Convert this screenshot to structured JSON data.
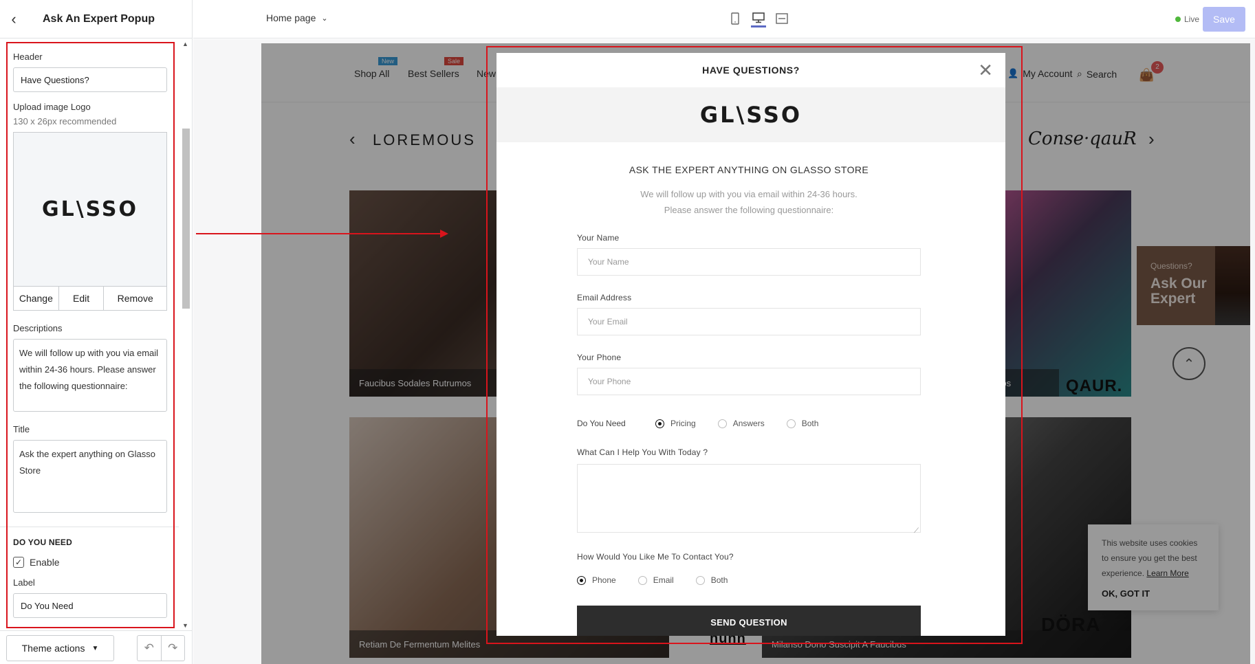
{
  "sidebar": {
    "title": "Ask An Expert Popup",
    "header_label": "Header",
    "header_value": "Have Questions?",
    "upload_label": "Upload image Logo",
    "upload_hint": "130 x 26px recommended",
    "logo_text": "GL\\SSO",
    "image_buttons": [
      "Change",
      "Edit",
      "Remove"
    ],
    "descriptions_label": "Descriptions",
    "descriptions_value": "We will follow up with you via email within 24-36 hours. Please answer the following questionnaire:",
    "title_label": "Title",
    "title_value": "Ask the expert anything on Glasso Store",
    "section_do_you_need": "DO YOU NEED",
    "enable_label": "Enable",
    "enable_checked": true,
    "label_label": "Label",
    "label_value": "Do You Need",
    "theme_actions": "Theme actions"
  },
  "topbar": {
    "page": "Home page",
    "live": "Live",
    "save": "Save"
  },
  "store": {
    "nav": [
      {
        "label": "Shop All",
        "badge": "New",
        "badge_color": "#3a9bd8"
      },
      {
        "label": "Best Sellers",
        "badge": "Sale",
        "badge_color": "#e0483e"
      },
      {
        "label": "New",
        "badge": "",
        "badge_color": ""
      }
    ],
    "my_account": "My Account",
    "search": "Search",
    "cart_count": "2",
    "brand_left": "LOREMOUS",
    "brand_right": "Conse·qauR",
    "tile_captions": [
      "Faucibus Sodales Rutrumos",
      "eratos",
      "Retiam De Fermentum Melites",
      "Milanso Dono Suscipit A Faucibus"
    ],
    "qaur": "QAUR.",
    "huhn": "huhn",
    "dora": "DÖRA",
    "ask_widget": {
      "question": "Questions?",
      "title": "Ask Our Expert"
    },
    "cookie": {
      "text": "This website uses cookies to ensure you get the best experience.",
      "learn_more": "Learn More",
      "ok": "OK, GOT IT"
    }
  },
  "modal": {
    "title": "HAVE QUESTIONS?",
    "logo_text": "GL\\SSO",
    "heading": "ASK THE EXPERT ANYTHING ON GLASSO STORE",
    "desc_line1": "We will follow up with you via email within 24-36 hours.",
    "desc_line2": "Please answer the following questionnaire:",
    "fields": [
      {
        "label": "Your Name",
        "placeholder": "Your Name"
      },
      {
        "label": "Email Address",
        "placeholder": "Your Email"
      },
      {
        "label": "Your Phone",
        "placeholder": "Your Phone"
      }
    ],
    "need_label": "Do You Need",
    "need_options": [
      "Pricing",
      "Answers",
      "Both"
    ],
    "need_selected": "Pricing",
    "help_label": "What Can I Help You With Today ?",
    "contact_label": "How Would You Like Me To Contact You?",
    "contact_options": [
      "Phone",
      "Email",
      "Both"
    ],
    "contact_selected": "Phone",
    "submit": "SEND QUESTION"
  },
  "colors": {
    "annotation": "#d9141c",
    "accent": "#5c6ac4",
    "save_disabled": "#b3bcf5"
  }
}
